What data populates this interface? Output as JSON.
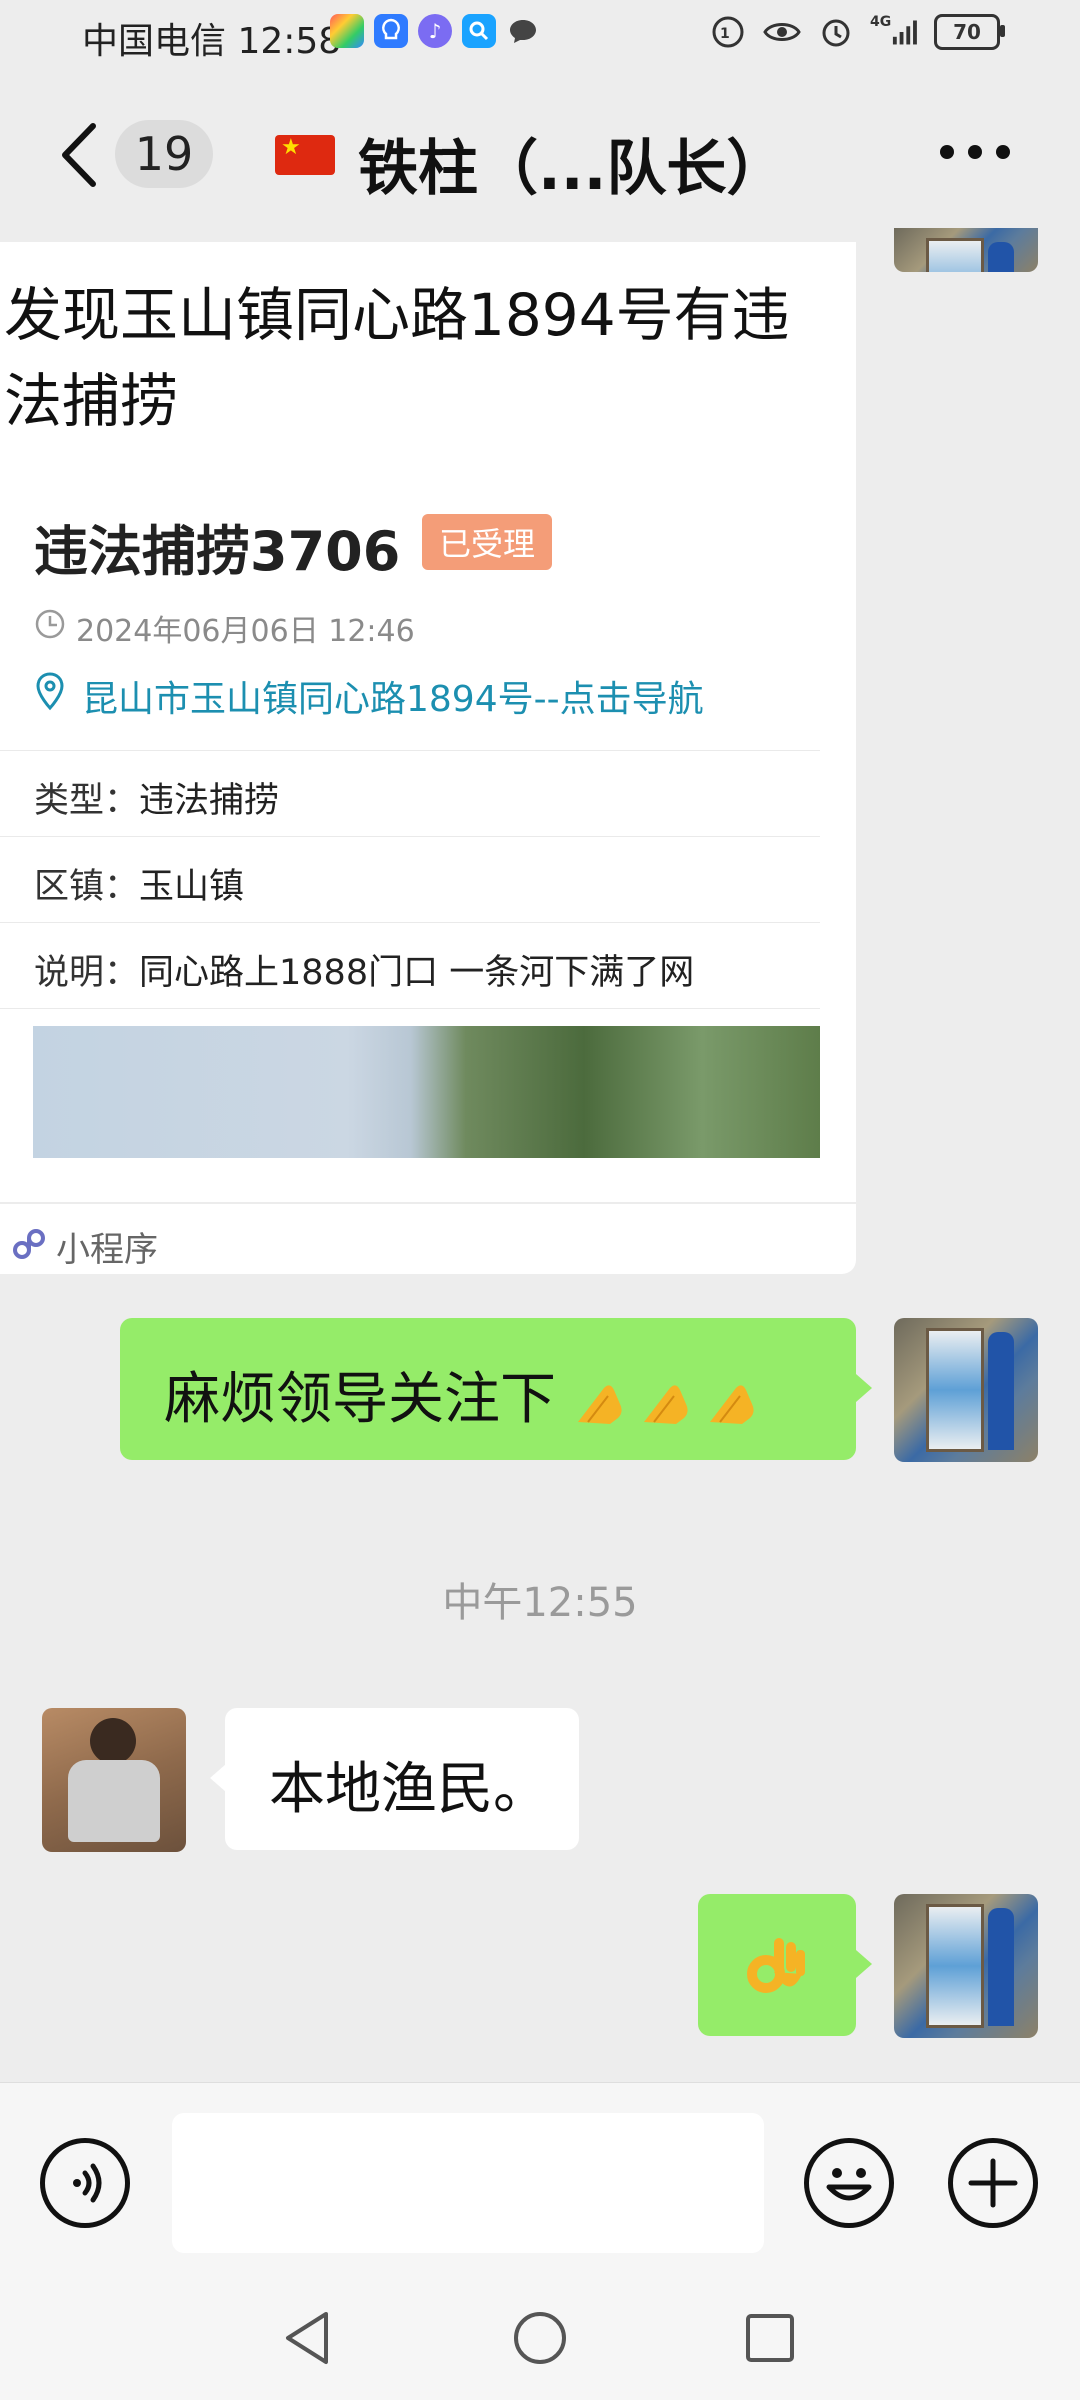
{
  "status_bar": {
    "carrier": "中国电信",
    "time": "12:58",
    "network_label": "4G",
    "battery": "70"
  },
  "header": {
    "back_count": "19",
    "title": "铁柱（...队长）",
    "icons": [
      "back-icon",
      "china-flag-icon",
      "more-icon"
    ]
  },
  "card": {
    "heading": "发现玉山镇同心路1894号有违法捕捞",
    "title": "违法捕捞3706",
    "status": "已受理",
    "time": "2024年06月06日 12:46",
    "location": "昆山市玉山镇同心路1894号--点击导航",
    "fields": [
      {
        "label": "类型：",
        "value": "违法捕捞"
      },
      {
        "label": "区镇：",
        "value": "玉山镇"
      },
      {
        "label": "说明：",
        "value": "同心路上1888门口 一条河下满了网"
      }
    ],
    "footer": "小程序"
  },
  "messages": [
    {
      "side": "right",
      "text": "麻烦领导关注下",
      "emoji": "🙏🙏🙏"
    },
    {
      "side": "left",
      "text": "本地渔民。"
    },
    {
      "side": "right",
      "emoji": "👌"
    }
  ],
  "timestamp": "中午12:55",
  "input_bar": {
    "icons": [
      "voice-icon",
      "emoji-icon",
      "plus-icon"
    ]
  },
  "nav_bar": {
    "icons": [
      "nav-back-icon",
      "nav-home-icon",
      "nav-recents-icon"
    ]
  },
  "colors": {
    "bubble_self": "#95ec69",
    "bubble_other": "#ffffff",
    "background": "#ededed",
    "status_badge": "#f49d78",
    "link": "#1c8fb0"
  }
}
